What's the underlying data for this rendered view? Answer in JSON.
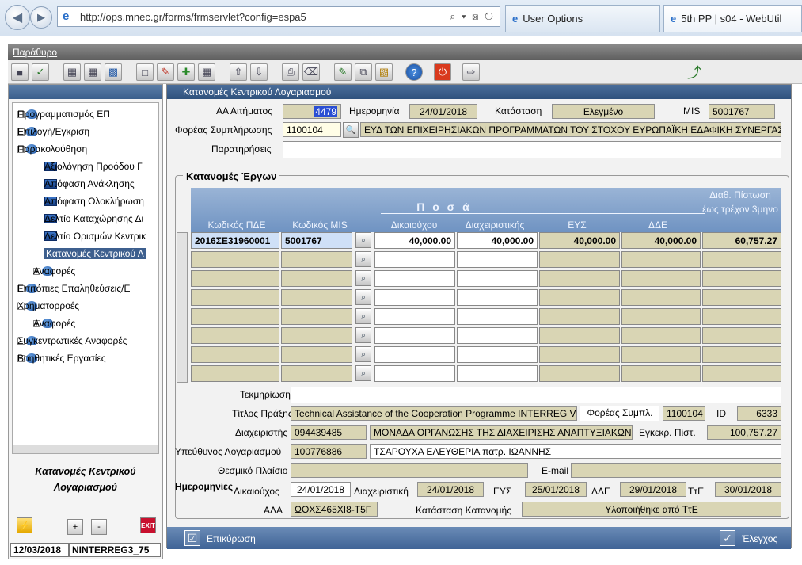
{
  "browser": {
    "url": "http://ops.mnec.gr/forms/frmservlet?config=espa5",
    "address_controls": "⌕ ▾ ⊠ ↻",
    "tabs": [
      "User Options",
      "5th PP | s04 - WebUtil"
    ]
  },
  "app_menu": "Παράθυρο",
  "sidebar": {
    "items": [
      {
        "label": "Προγραμματισμός ΕΠ",
        "type": "folder",
        "exp": "+"
      },
      {
        "label": "Επιλογή/Εγκριση",
        "type": "folder",
        "exp": "+"
      },
      {
        "label": "Παρακολούθηση",
        "type": "folder",
        "exp": "−"
      },
      {
        "label": "Αξιολόγηση Προόδου Γ",
        "type": "doc"
      },
      {
        "label": "Απόφαση Ανάκλησης",
        "type": "doc"
      },
      {
        "label": "Απόφαση Ολοκλήρωση",
        "type": "doc"
      },
      {
        "label": "Δελτίο Καταχώρησης Δι",
        "type": "doc"
      },
      {
        "label": "Δελτίο Ορισμών Κεντρικ",
        "type": "doc"
      },
      {
        "label": "Κατανομές Κεντρικού Λ",
        "type": "doc",
        "selected": true
      },
      {
        "label": "Αναφορές",
        "type": "folder",
        "exp": "+"
      },
      {
        "label": "Επιτόπιες Επαληθεύσεις/Ε",
        "type": "folder",
        "exp": "+"
      },
      {
        "label": "Χρηματορροές",
        "type": "folder",
        "exp": "−"
      },
      {
        "label": "Αναφορές",
        "type": "folder",
        "exp": "+"
      },
      {
        "label": "Συγκεντρωτικές Αναφορές",
        "type": "folder",
        "exp": "+"
      },
      {
        "label": "Βοηθητικές Εργασίες",
        "type": "folder",
        "exp": "+"
      }
    ],
    "caption": "Κατανομές Κεντρικού Λογαριασμού",
    "plus": "+",
    "minus": "-",
    "exit": "EXIT",
    "status_date": "12/03/2018",
    "status_code": "NINTERREG3_75"
  },
  "form": {
    "title": "Κατανομές Κεντρικού Λογαριασμού",
    "aa_label": "ΑΑ Αιτήματος",
    "aa_value": "4479",
    "date_label": "Ημερομηνία",
    "date_value": "24/01/2018",
    "status_label": "Κατάσταση",
    "status_value": "Ελεγμένο",
    "mis_label": "MIS",
    "mis_value": "5001767",
    "body_label": "Φορέας Συμπλήρωσης",
    "body_code": "1100104",
    "body_name": "ΕΥΔ ΤΩΝ ΕΠΙΧΕΙΡΗΣΙΑΚΩΝ ΠΡΟΓΡΑΜΜΑΤΩΝ ΤΟΥ ΣΤΟΧΟΥ ΕΥΡΩΠΑΪΚΗ ΕΔΑΦΙΚΗ ΣΥΝΕΡΓΑΣΙΑ",
    "notes_label": "Παρατηρήσεις",
    "section_title": "Κατανομές Έργων",
    "grid": {
      "group_header": "Π ο σ ά",
      "col_pde": "Κωδικός ΠΔΕ",
      "col_mis": "Κωδικός MIS",
      "col_beneficiary": "Δικαιούχου",
      "col_managing": "Διαχειριστικής",
      "col_eys": "ΕΥΣ",
      "col_dde": "ΔΔΕ",
      "col_available": "Διαθ. Πίστωση έως τρέχον 3μηνο",
      "rows": [
        {
          "pde": "2016ΣΕ31960001",
          "mis": "5001767",
          "beneficiary": "40,000.00",
          "managing": "40,000.00",
          "eys": "40,000.00",
          "dde": "40,000.00",
          "available": "60,757.27"
        },
        {
          "pde": "",
          "mis": "",
          "beneficiary": "",
          "managing": "",
          "eys": "",
          "dde": "",
          "available": ""
        },
        {
          "pde": "",
          "mis": "",
          "beneficiary": "",
          "managing": "",
          "eys": "",
          "dde": "",
          "available": ""
        },
        {
          "pde": "",
          "mis": "",
          "beneficiary": "",
          "managing": "",
          "eys": "",
          "dde": "",
          "available": ""
        },
        {
          "pde": "",
          "mis": "",
          "beneficiary": "",
          "managing": "",
          "eys": "",
          "dde": "",
          "available": ""
        },
        {
          "pde": "",
          "mis": "",
          "beneficiary": "",
          "managing": "",
          "eys": "",
          "dde": "",
          "available": ""
        },
        {
          "pde": "",
          "mis": "",
          "beneficiary": "",
          "managing": "",
          "eys": "",
          "dde": "",
          "available": ""
        },
        {
          "pde": "",
          "mis": "",
          "beneficiary": "",
          "managing": "",
          "eys": "",
          "dde": "",
          "available": ""
        }
      ]
    },
    "justification_label": "Τεκμηρίωση",
    "action_title_label": "Τίτλος Πράξης",
    "action_title_value": "Technical Assistance of the Cooperation Programme INTERREG V",
    "body_short_label": "Φορέας Συμπλ.",
    "body_short_value": "1100104",
    "id_label": "ID",
    "id_value": "6333",
    "manager_label": "Διαχειριστής",
    "manager_code": "094439485",
    "manager_name": "ΜΟΝΑΔΑ ΟΡΓΑΝΩΣΗΣ ΤΗΣ ΔΙΑΧΕΙΡΙΣΗΣ ΑΝΑΠΤΥΞΙΑΚΩΝ ΠΡ",
    "approved_label": "Εγκεκρ. Πίστ.",
    "approved_value": "100,757.27",
    "account_label": "Υπεύθυνος Λογαριασμού",
    "account_code": "100776886",
    "account_name": "ΤΣΑΡΟΥΧΑ ΕΛΕΥΘΕΡΙΑ πατρ. ΙΩΑΝΝΗΣ",
    "framework_label": "Θεσμικό Πλαίσιο",
    "email_label": "E-mail",
    "dates_label": "Ημερομηνίες",
    "beneficiary_date_label": "Δικαιούχος",
    "beneficiary_date": "24/01/2018",
    "managing_date_label": "Διαχειριστική",
    "managing_date": "24/01/2018",
    "eys_date_label": "ΕΥΣ",
    "eys_date": "25/01/2018",
    "dde_date_label": "ΔΔΕ",
    "dde_date": "29/01/2018",
    "tte_date_label": "ΤτΕ",
    "tte_date": "30/01/2018",
    "ada_label": "ΑΔΑ",
    "ada_value": "ΩΟΧΣ465ΧΙ8-Τ5Γ",
    "alloc_status_label": "Κατάσταση Κατανομής",
    "alloc_status_value": "Υλοποιήθηκε από ΤτΕ",
    "confirm_label": "Επικύρωση",
    "check_label": "Έλεγχος"
  }
}
